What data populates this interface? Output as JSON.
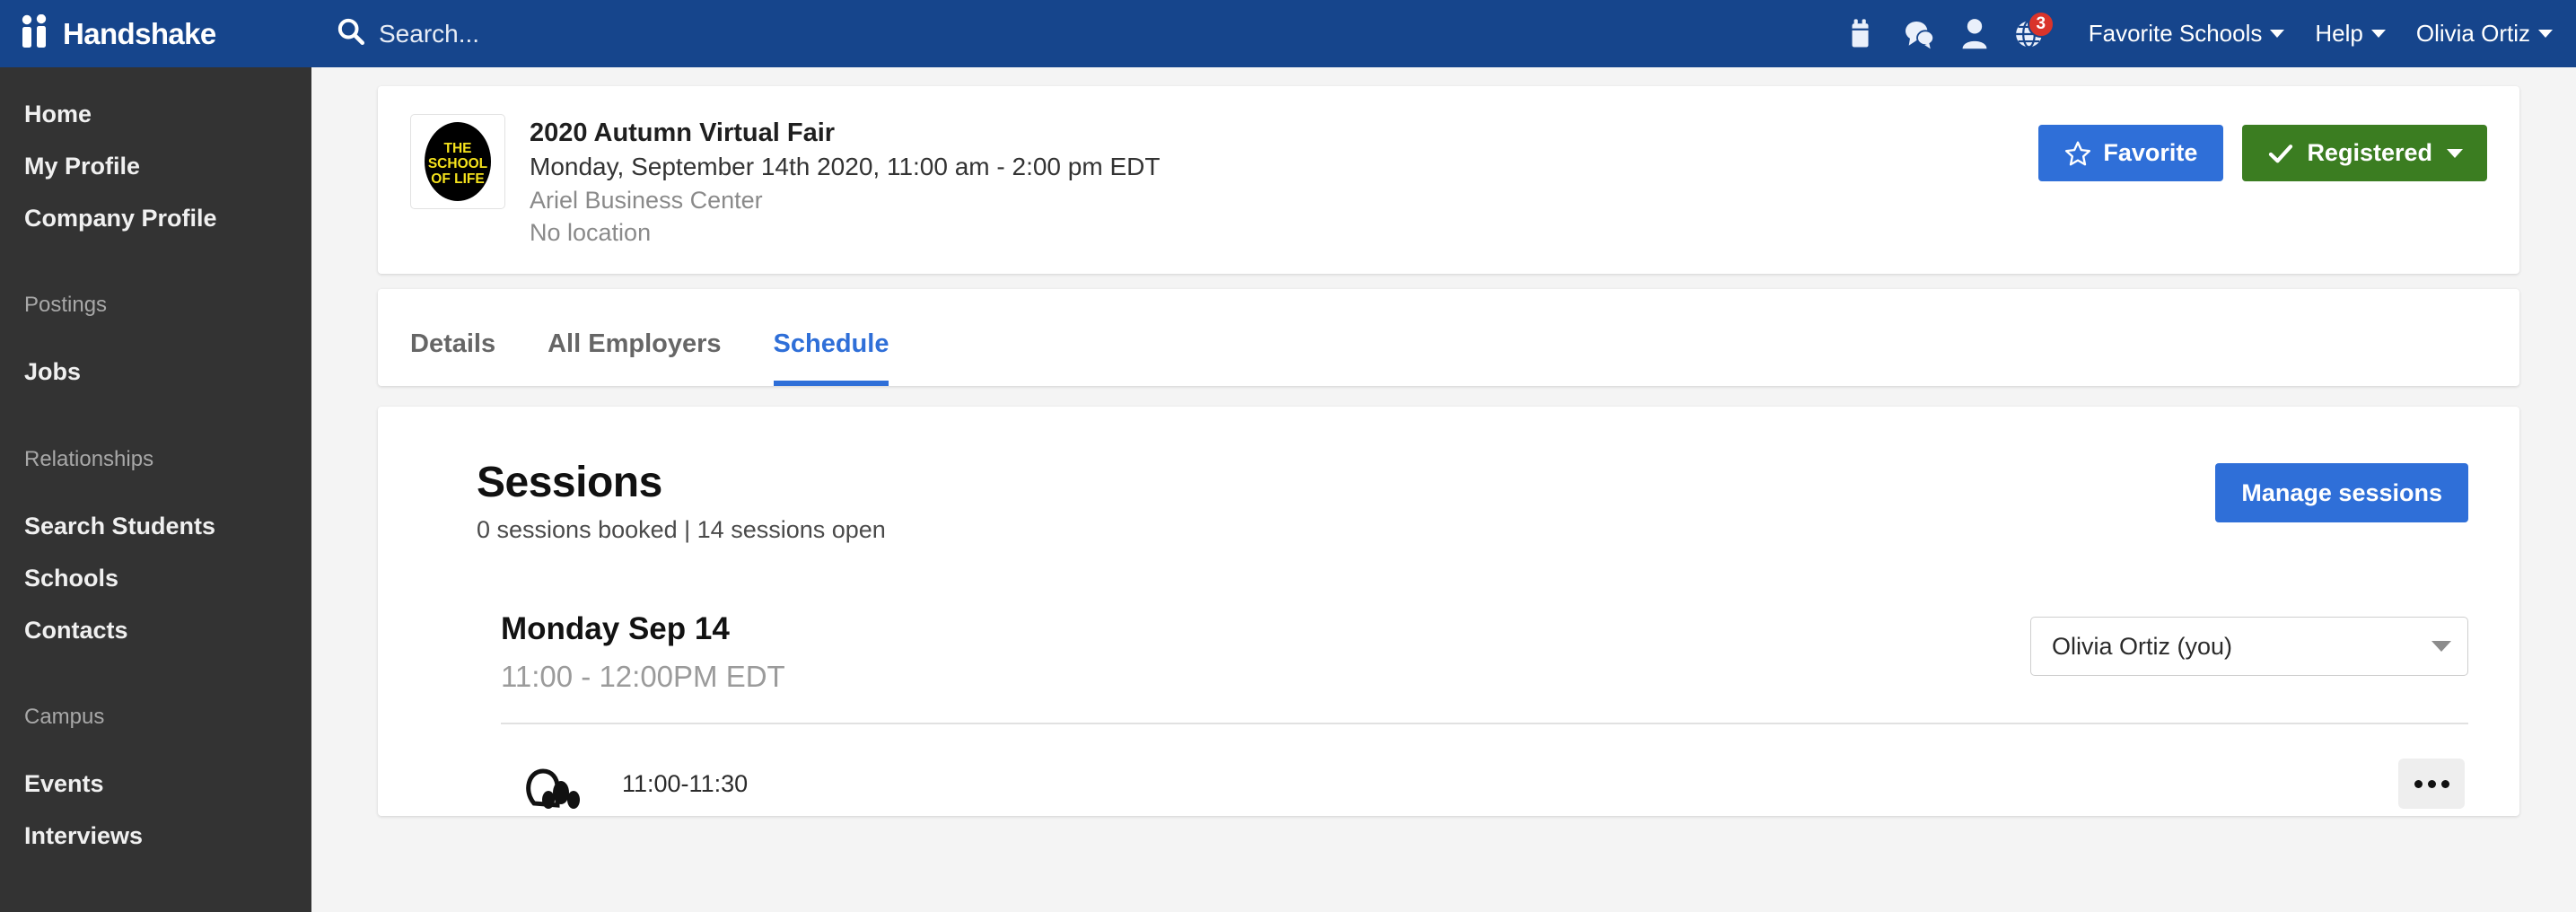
{
  "topnav": {
    "brand": "Handshake",
    "brand_icon": "handshake-people-logo",
    "search_placeholder": "Search...",
    "search_value": "",
    "search_icon": "search-icon",
    "icons": [
      {
        "name": "calendar-icon",
        "badge": ""
      },
      {
        "name": "messages-icon",
        "badge": ""
      },
      {
        "name": "person-icon",
        "badge": ""
      },
      {
        "name": "globe-icon",
        "badge": "3"
      }
    ],
    "links": [
      {
        "label": "Favorite Schools",
        "caret": true
      },
      {
        "label": "Help",
        "caret": true
      },
      {
        "label": "Olivia Ortiz",
        "caret": true
      }
    ]
  },
  "sidebar": {
    "primary": [
      {
        "label": "Home"
      },
      {
        "label": "My Profile"
      },
      {
        "label": "Company Profile"
      }
    ],
    "groups": [
      {
        "heading": "Postings",
        "items": [
          {
            "label": "Jobs"
          }
        ]
      },
      {
        "heading": "Relationships",
        "items": [
          {
            "label": "Search Students"
          },
          {
            "label": "Schools"
          },
          {
            "label": "Contacts"
          }
        ]
      },
      {
        "heading": "Campus",
        "items": [
          {
            "label": "Events"
          },
          {
            "label": "Interviews"
          }
        ]
      }
    ]
  },
  "event": {
    "logo_alt": "THE SCHOOL OF LIFE",
    "logo_lines": [
      "THE",
      "SCHOOL",
      "OF LIFE"
    ],
    "title": "2020 Autumn Virtual Fair",
    "datetime": "Monday, September 14th 2020, 11:00 am - 2:00 pm EDT",
    "organizer": "Ariel Business Center",
    "location": "No location",
    "favorite_label": "Favorite",
    "favorite_icon": "star-outline-icon",
    "registered_label": "Registered",
    "registered_icon": "check-icon"
  },
  "tabs": [
    {
      "label": "Details",
      "active": false
    },
    {
      "label": "All Employers",
      "active": false
    },
    {
      "label": "Schedule",
      "active": true
    }
  ],
  "sessions": {
    "title": "Sessions",
    "summary": "0 sessions booked | 14 sessions open",
    "manage_label": "Manage sessions",
    "day": {
      "title": "Monday Sep 14",
      "time_range": "11:00 - 12:00PM EDT",
      "owner_select_value": "Olivia Ortiz (you)"
    },
    "slots": [
      {
        "time": "11:00-11:30",
        "avatar": "company-avatar-icon",
        "menu_icon": "kebab-menu-icon"
      }
    ]
  },
  "colors": {
    "nav_blue": "#16458c",
    "accent_blue": "#2f6fd8",
    "green": "#3b7d21",
    "badge_red": "#d9342b",
    "sidebar_dark": "#333333",
    "page_bg": "#f4f4f4"
  }
}
